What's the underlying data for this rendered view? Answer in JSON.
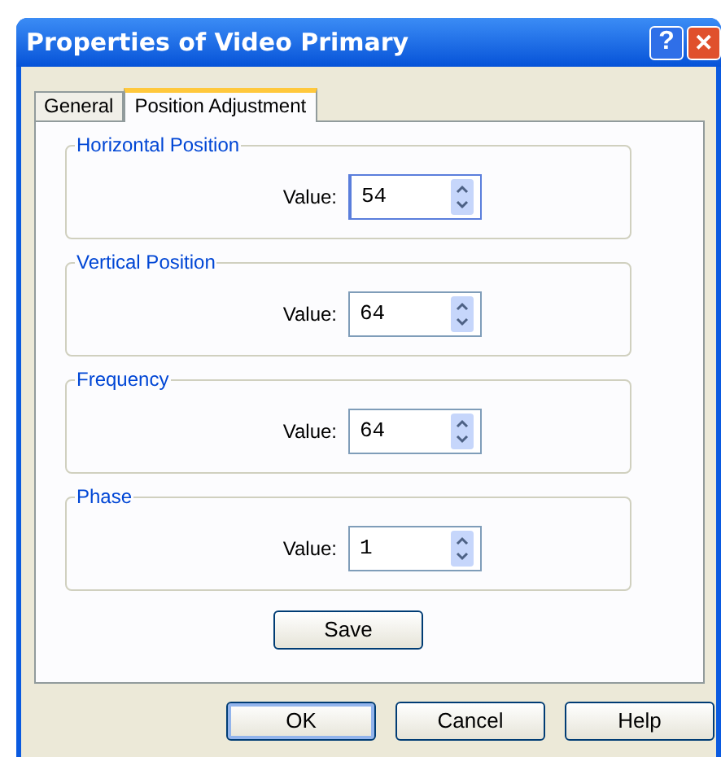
{
  "window": {
    "title": "Properties of Video Primary"
  },
  "title_buttons": [
    {
      "kind": "help",
      "label": "?"
    },
    {
      "kind": "close",
      "label": "✕"
    }
  ],
  "tabs": [
    {
      "label": "General",
      "selected": false
    },
    {
      "label": "Position Adjustment",
      "selected": true
    }
  ],
  "groups": [
    {
      "title": "Horizontal Position",
      "label": "Value:",
      "value": "54",
      "focused": true
    },
    {
      "title": "Vertical Position",
      "label": "Value:",
      "value": "64",
      "focused": false
    },
    {
      "title": "Frequency",
      "label": "Value:",
      "value": "64",
      "focused": false
    },
    {
      "title": "Phase",
      "label": "Value:",
      "value": "1",
      "focused": false
    }
  ],
  "save_button": "Save",
  "buttons": [
    {
      "label": "OK",
      "default": true
    },
    {
      "label": "Cancel",
      "default": false
    },
    {
      "label": "Help",
      "default": false
    }
  ]
}
